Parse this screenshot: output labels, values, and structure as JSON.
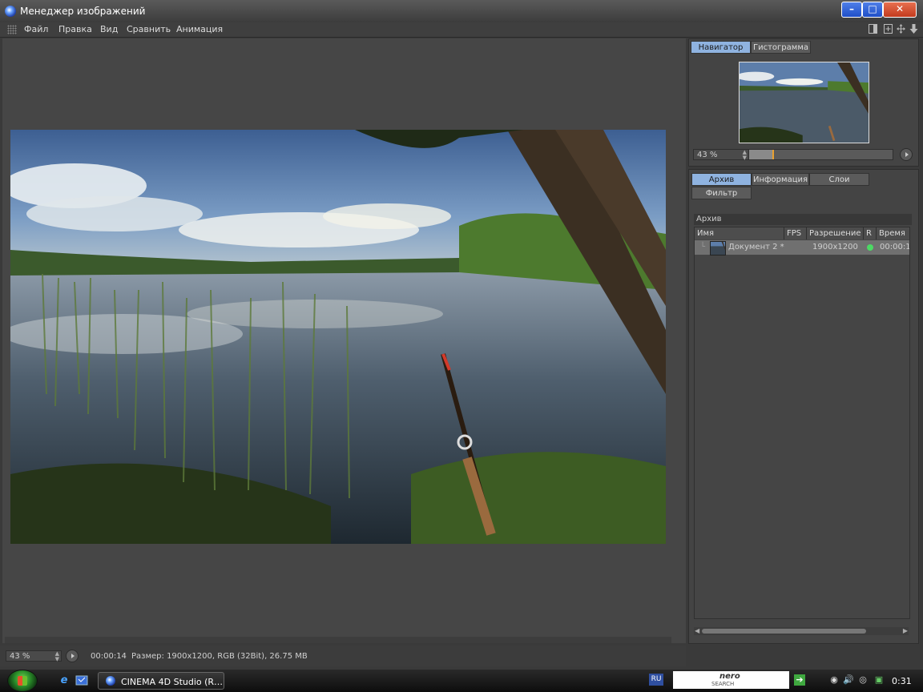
{
  "window": {
    "title": "Менеджер изображений",
    "controls": {
      "minimize": "–",
      "maximize": "□",
      "close": "✕"
    }
  },
  "menu": {
    "items": [
      "Файл",
      "Правка",
      "Вид",
      "Сравнить",
      "Анимация"
    ]
  },
  "navigator": {
    "tabs": [
      "Навигатор",
      "Гистограмма"
    ],
    "active_tab": "Навигатор",
    "zoom": "43 %",
    "position_fraction": 0.16
  },
  "archive": {
    "tabs": [
      "Архив",
      "Информация",
      "Слои",
      "Фильтр"
    ],
    "active_tab": "Архив",
    "section_title": "Архив",
    "columns": [
      "Имя",
      "FPS",
      "Разрешение",
      "R",
      "Время"
    ],
    "rows": [
      {
        "name": "Документ 2 *",
        "fps": "",
        "resolution": "1900x1200",
        "r_status_color": "#4cd964",
        "time": "00:00:1"
      }
    ]
  },
  "status": {
    "zoom": "43 %",
    "time": "00:00:14",
    "info": "Размер: 1900x1200, RGB (32Bit), 26.75 MB"
  },
  "taskbar": {
    "task_label": "CINEMA 4D Studio (R…",
    "language": "RU",
    "nero_brand": "nero",
    "nero_search": "SEARCH",
    "clock": "0:31"
  },
  "colors": {
    "tab_active": "#8fb3e0",
    "accent_knob": "#e8a030",
    "panel_bg": "#444444"
  }
}
